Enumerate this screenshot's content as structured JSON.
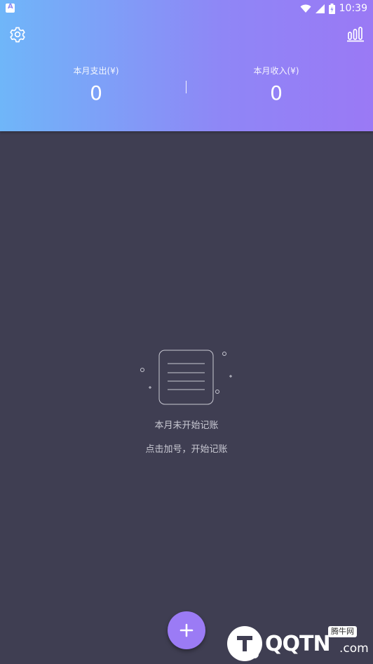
{
  "status_bar": {
    "time": "10:39",
    "left_icon": "notification-a-icon",
    "icons": [
      "wifi-icon",
      "signal-icon",
      "battery-icon"
    ]
  },
  "header": {
    "settings_icon": "gear-icon",
    "stats_icon": "bar-chart-icon",
    "gradient_start": "#6fb6f9",
    "gradient_end": "#9a79f5",
    "expense": {
      "label": "本月支出(¥)",
      "value": "0"
    },
    "income": {
      "label": "本月收入(¥)",
      "value": "0"
    }
  },
  "main": {
    "background": "#3f3e52",
    "empty_icon": "empty-ledger-icon",
    "empty_title": "本月未开始记账",
    "empty_hint": "点击加号，开始记账"
  },
  "fab": {
    "icon": "plus-icon",
    "color": "#9b7bf5"
  },
  "watermark": {
    "text": "QQTN",
    "suffix": ".com",
    "tag": "腾牛网"
  }
}
